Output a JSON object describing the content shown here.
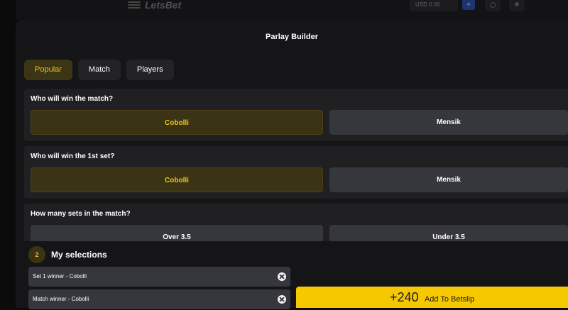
{
  "header": {
    "logo_text": "LetsBet",
    "balance": "USD 0.00",
    "deposit_icon": "plus-icon",
    "search_icon": "search-icon",
    "user_icon": "user-icon"
  },
  "modal": {
    "title": "Parlay Builder",
    "tabs": [
      {
        "label": "Popular",
        "active": true
      },
      {
        "label": "Match",
        "active": false
      },
      {
        "label": "Players",
        "active": false
      }
    ]
  },
  "markets": [
    {
      "question": "Who will win the match?",
      "options": [
        {
          "label": "Cobolli",
          "selected": true
        },
        {
          "label": "Mensik",
          "selected": false
        }
      ]
    },
    {
      "question": "Who will win the 1st set?",
      "options": [
        {
          "label": "Cobolli",
          "selected": true
        },
        {
          "label": "Mensik",
          "selected": false
        }
      ]
    },
    {
      "question": "How many sets in the match?",
      "options": [
        {
          "label": "Over 3.5",
          "selected": false
        },
        {
          "label": "Under 3.5",
          "selected": false
        }
      ]
    }
  ],
  "selections": {
    "count": "2",
    "title": "My selections",
    "items": [
      {
        "label": "Set 1 winner - Cobolli"
      },
      {
        "label": "Match winner - Cobolli"
      }
    ]
  },
  "betslip": {
    "odds": "+240",
    "label": "Add To Betslip"
  },
  "colors": {
    "accent": "#f2c418",
    "button_primary": "#f6c800",
    "background": "#151517",
    "option_unselected": "#36373c"
  }
}
